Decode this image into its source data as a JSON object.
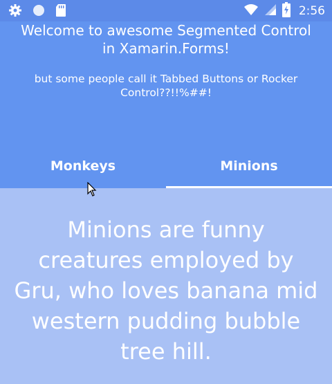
{
  "status_bar": {
    "time": "2:56",
    "left_icons": [
      "gear-icon",
      "circle-icon",
      "sd-card-icon"
    ],
    "right_icons": [
      "wifi-icon",
      "signal-icon",
      "battery-charging-icon"
    ]
  },
  "header": {
    "title": "Welcome to awesome Segmented Control in Xamarin.Forms!",
    "subtitle": "but some people call it Tabbed Buttons or Rocker Control??!!%##!"
  },
  "tabs": [
    {
      "label": "Monkeys",
      "selected": false
    },
    {
      "label": "Minions",
      "selected": true
    }
  ],
  "content": {
    "text": "Minions are funny creatures employed by Gru, who loves banana mid western pudding bubble tree hill."
  },
  "colors": {
    "status_bar": "#5c8ae8",
    "header": "#6294f0",
    "content": "#a9c1f5",
    "text": "#ffffff"
  }
}
